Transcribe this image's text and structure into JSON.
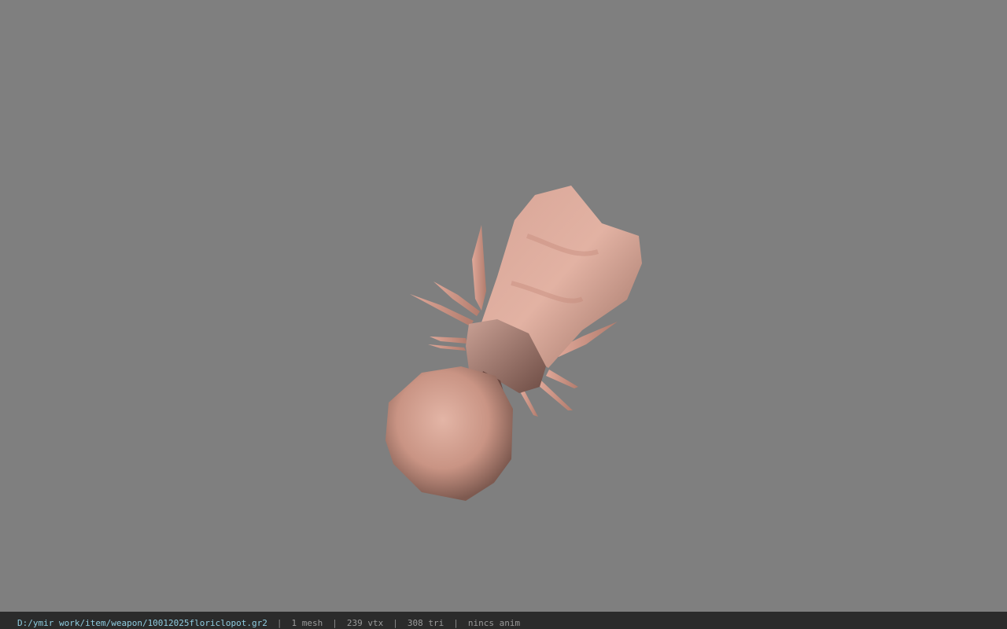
{
  "viewport": {
    "background_color": "#7f7f7f",
    "model_color": "#d4a090"
  },
  "status_bar": {
    "file_path": "D:/ymir work/item/weapon/10012025floriclopot.gr2",
    "separator": "|",
    "mesh_count": "1 mesh",
    "vertex_count": "239 vtx",
    "triangle_count": "308 tri",
    "anim_status": "nincs anim",
    "path_color": "#8fcce0",
    "background_color": "#2b2b2b"
  }
}
